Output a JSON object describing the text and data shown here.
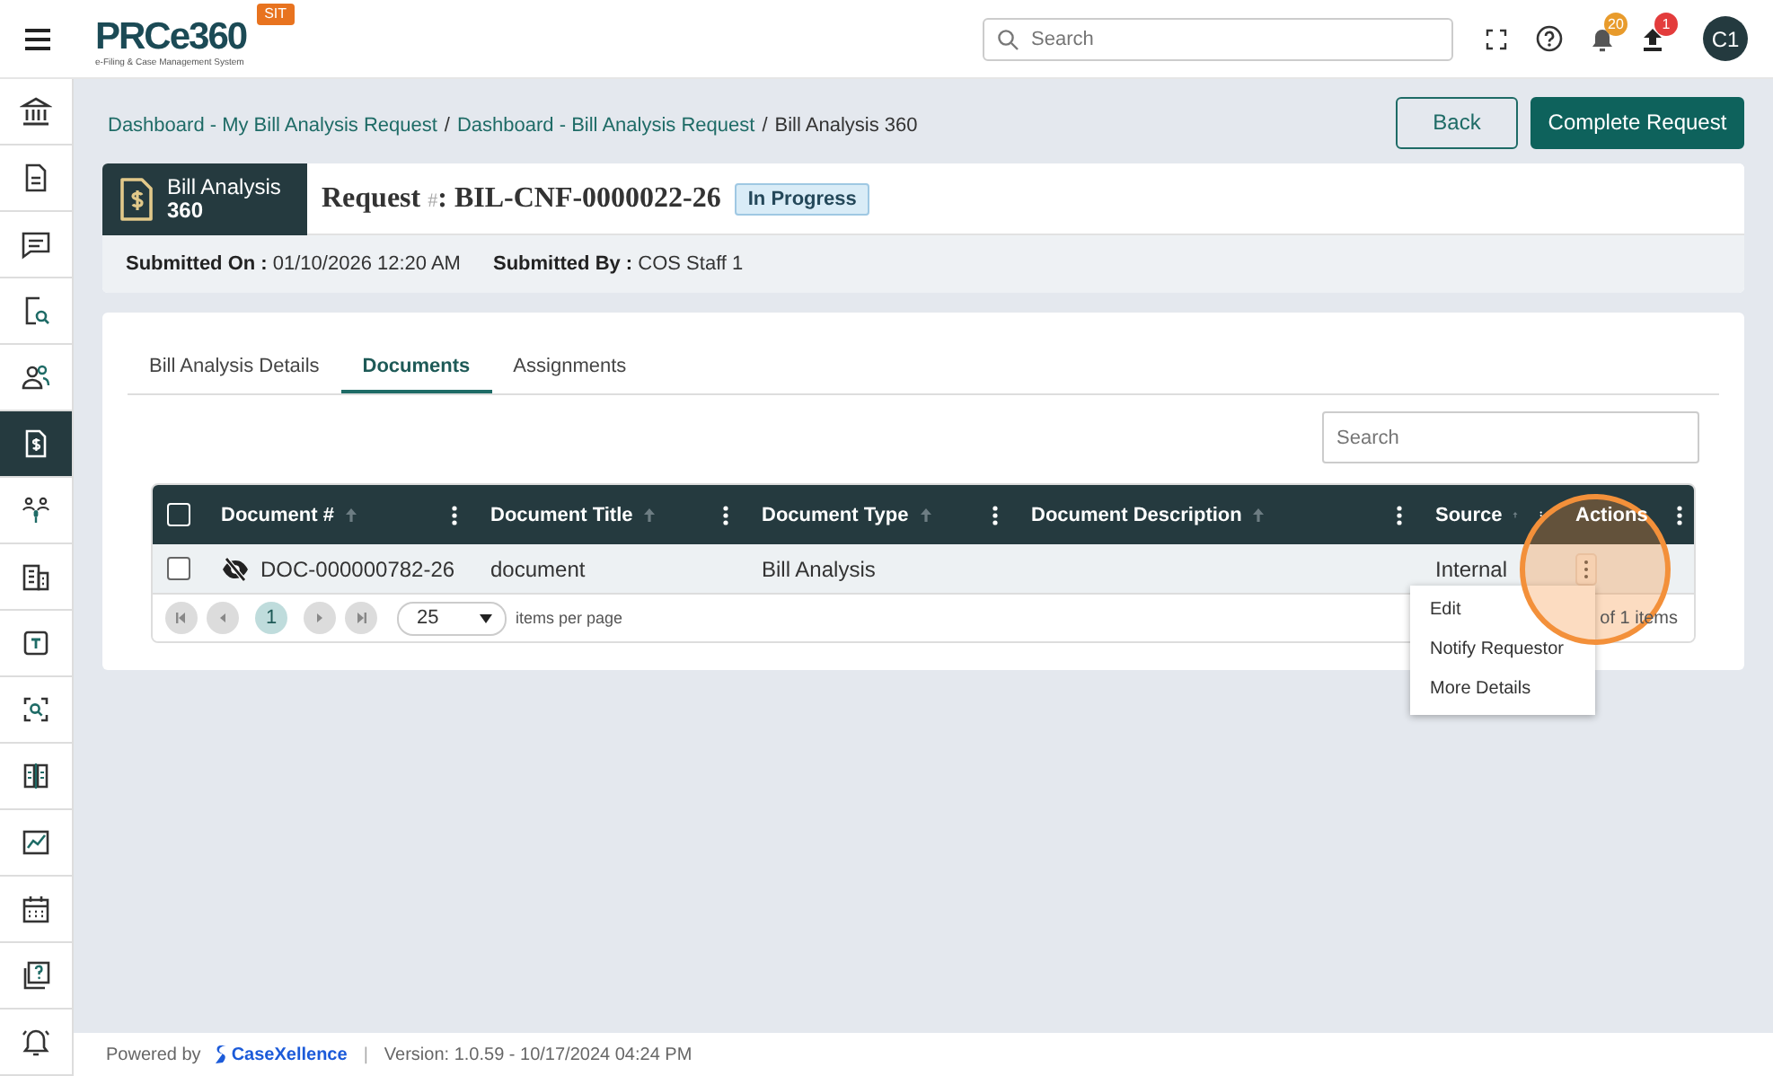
{
  "header": {
    "logo": "PRCe360",
    "logo_tagline": "e-Filing & Case Management System",
    "env_badge": "SIT",
    "search": {
      "placeholder": "Search"
    },
    "notifications_count": "20",
    "uploads_count": "1",
    "avatar": "C1"
  },
  "sidebar": {
    "items": [
      {
        "selected": false
      },
      {
        "selected": false
      },
      {
        "selected": false
      },
      {
        "selected": false
      },
      {
        "selected": false
      },
      {
        "selected": true
      },
      {
        "selected": false
      },
      {
        "selected": false
      },
      {
        "selected": false
      },
      {
        "selected": false
      },
      {
        "selected": false
      },
      {
        "selected": false
      },
      {
        "selected": false
      },
      {
        "selected": false
      },
      {
        "selected": false
      }
    ]
  },
  "breadcrumb": {
    "separator": "/",
    "items": [
      "Dashboard - My Bill Analysis Request",
      "Dashboard - Bill Analysis Request",
      "Bill Analysis 360"
    ]
  },
  "actions": [
    {
      "label": "Back",
      "kind": "outline"
    },
    {
      "label": "Complete Request",
      "kind": "primary"
    }
  ],
  "request": {
    "module_title": "Bill Analysis",
    "module_subtitle": "360",
    "title_prefix": "Request",
    "title_mark": "#",
    "title_suffix": ": BIL-CNF-0000022-26",
    "status": "In Progress"
  },
  "meta": [
    {
      "label": "Submitted On :",
      "value": "01/10/2026 12:20 AM"
    },
    {
      "label": "Submitted By :",
      "value": "COS Staff 1"
    }
  ],
  "tabs": [
    {
      "label": "Bill Analysis Details",
      "selected": false
    },
    {
      "label": "Documents",
      "selected": true
    },
    {
      "label": "Assignments",
      "selected": false
    }
  ],
  "grid_search": {
    "placeholder": "Search"
  },
  "table": {
    "select_all": {
      "checked": false
    },
    "columns": [
      {
        "label": "Document #",
        "sortable": true
      },
      {
        "label": "Document Title",
        "sortable": true
      },
      {
        "label": "Document Type",
        "sortable": true
      },
      {
        "label": "Document Description",
        "sortable": true
      },
      {
        "label": "Source",
        "sortable": true
      },
      {
        "label": "Actions",
        "sortable": false
      }
    ],
    "rows": [
      {
        "checked": false,
        "hidden": true,
        "cells": [
          "DOC-000000782-26",
          "document",
          "Bill Analysis",
          "",
          "Internal"
        ]
      }
    ]
  },
  "pager": {
    "pages": [
      {
        "label": "1",
        "selected": true
      }
    ],
    "page_size": "25",
    "page_size_label": "items per page",
    "summary": "of 1 items"
  },
  "context_menu": {
    "items": [
      "Edit",
      "Notify Requestor",
      "More Details"
    ]
  },
  "footer": {
    "powered_by": "Powered by",
    "brand": "CaseXellence",
    "separator": "|",
    "version": "Version: 1.0.59 - 10/17/2024 04:24 PM"
  }
}
